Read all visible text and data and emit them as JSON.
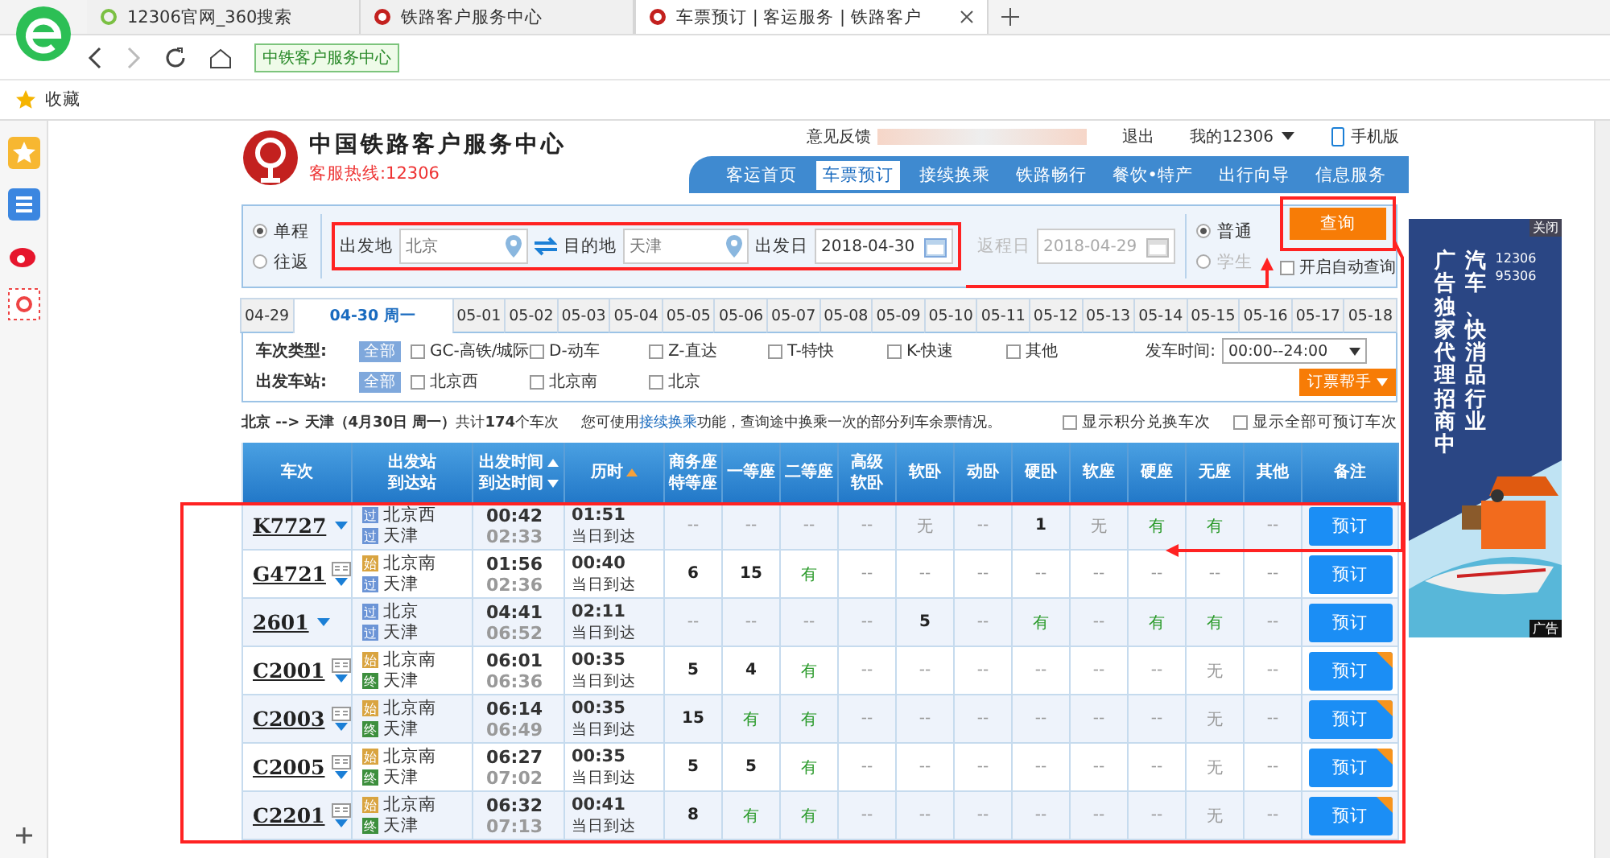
{
  "browser": {
    "tabs": [
      {
        "title": "12306官网_360搜索",
        "kind": "search",
        "selected": false
      },
      {
        "title": "铁路客户服务中心",
        "kind": "site",
        "selected": false
      },
      {
        "title": "车票预订 | 客运服务 | 铁路客户",
        "kind": "site",
        "selected": true
      }
    ],
    "site_badge": "中铁客户服务中心",
    "bookmarks_label": "收藏"
  },
  "header": {
    "title": "中国铁路客户服务中心",
    "hotline": "客服热线:12306",
    "feedback": "意见反馈",
    "logout": "退出",
    "account": "我的12306",
    "mobile": "手机版",
    "nav": [
      {
        "label": "客运首页",
        "selected": false
      },
      {
        "label": "车票预订",
        "selected": true
      },
      {
        "label": "接续换乘",
        "selected": false
      },
      {
        "label": "铁路畅行",
        "selected": false
      },
      {
        "label": "餐饮•特产",
        "selected": false
      },
      {
        "label": "出行向导",
        "selected": false
      },
      {
        "label": "信息服务",
        "selected": false
      }
    ]
  },
  "search": {
    "trip": [
      {
        "label": "单程",
        "selected": true
      },
      {
        "label": "往返",
        "selected": false
      }
    ],
    "from": {
      "label": "出发地",
      "value": "北京"
    },
    "to": {
      "label": "目的地",
      "value": "天津"
    },
    "date": {
      "label": "出发日",
      "value": "2018-04-30",
      "disabled": false
    },
    "return": {
      "label": "返程日",
      "value": "2018-04-29",
      "disabled": true
    },
    "passenger": [
      {
        "label": "普通",
        "selected": true,
        "disabled": false
      },
      {
        "label": "学生",
        "selected": false,
        "disabled": true
      }
    ],
    "submit": "查询",
    "auto_query": {
      "label": "开启自动查询",
      "checked": false
    }
  },
  "dates": [
    {
      "label": "04-29",
      "selected": false
    },
    {
      "label": "04-30 周一",
      "selected": true
    },
    {
      "label": "05-01",
      "selected": false
    },
    {
      "label": "05-02",
      "selected": false
    },
    {
      "label": "05-03",
      "selected": false
    },
    {
      "label": "05-04",
      "selected": false
    },
    {
      "label": "05-05",
      "selected": false
    },
    {
      "label": "05-06",
      "selected": false
    },
    {
      "label": "05-07",
      "selected": false
    },
    {
      "label": "05-08",
      "selected": false
    },
    {
      "label": "05-09",
      "selected": false
    },
    {
      "label": "05-10",
      "selected": false
    },
    {
      "label": "05-11",
      "selected": false
    },
    {
      "label": "05-12",
      "selected": false
    },
    {
      "label": "05-13",
      "selected": false
    },
    {
      "label": "05-14",
      "selected": false
    },
    {
      "label": "05-15",
      "selected": false
    },
    {
      "label": "05-16",
      "selected": false
    },
    {
      "label": "05-17",
      "selected": false
    },
    {
      "label": "05-18",
      "selected": false
    }
  ],
  "filters": [
    {
      "label": "车次类型:",
      "all": "全部",
      "options": [
        {
          "label": "GC-高铁/城际",
          "checked": false
        },
        {
          "label": "D-动车",
          "checked": false
        },
        {
          "label": "Z-直达",
          "checked": false
        },
        {
          "label": "T-特快",
          "checked": false
        },
        {
          "label": "K-快速",
          "checked": false
        },
        {
          "label": "其他",
          "checked": false
        }
      ]
    },
    {
      "label": "出发车站:",
      "all": "全部",
      "options": [
        {
          "label": "北京西",
          "checked": false
        },
        {
          "label": "北京南",
          "checked": false
        },
        {
          "label": "北京",
          "checked": false
        }
      ]
    }
  ],
  "time_filter": {
    "label": "发车时间:",
    "value": "00:00--24:00"
  },
  "helper": "订票帮手",
  "summary": "**北京 --> 天津（4月30日  周一）**共计**174**个车次",
  "tip": {
    "before": "您可使用",
    "link": "接续换乘",
    "after": "功能，查询途中换乘一次的部分列车余票情况。"
  },
  "options": [
    {
      "label": "显示积分兑换车次",
      "checked": false
    },
    {
      "label": "显示全部可预订车次",
      "checked": false
    }
  ],
  "table": {
    "columns": [
      {
        "lines": [
          "车次"
        ],
        "sortable": false,
        "sorted": false
      },
      {
        "lines": [
          "出发站",
          "到达站"
        ],
        "sortable": false,
        "sorted": false
      },
      {
        "lines": [
          "出发时间",
          "到达时间"
        ],
        "sortable": true,
        "sorted": false
      },
      {
        "lines": [
          "历时"
        ],
        "sortable": true,
        "sorted": true
      },
      {
        "lines": [
          "商务座",
          "特等座"
        ],
        "sortable": false,
        "sorted": false
      },
      {
        "lines": [
          "一等座"
        ],
        "sortable": false,
        "sorted": false
      },
      {
        "lines": [
          "二等座"
        ],
        "sortable": false,
        "sorted": false
      },
      {
        "lines": [
          "高级",
          "软卧"
        ],
        "sortable": false,
        "sorted": false
      },
      {
        "lines": [
          "软卧"
        ],
        "sortable": false,
        "sorted": false
      },
      {
        "lines": [
          "动卧"
        ],
        "sortable": false,
        "sorted": false
      },
      {
        "lines": [
          "硬卧"
        ],
        "sortable": false,
        "sorted": false
      },
      {
        "lines": [
          "软座"
        ],
        "sortable": false,
        "sorted": false
      },
      {
        "lines": [
          "硬座"
        ],
        "sortable": false,
        "sorted": false
      },
      {
        "lines": [
          "无座"
        ],
        "sortable": false,
        "sorted": false
      },
      {
        "lines": [
          "其他"
        ],
        "sortable": false,
        "sorted": false
      },
      {
        "lines": [
          "备注"
        ],
        "sortable": false,
        "sorted": false
      }
    ],
    "rows": [
      {
        "train": "K7727",
        "id_card": false,
        "from": {
          "badge": "过",
          "kind": "pass",
          "name": "北京西"
        },
        "to": {
          "badge": "过",
          "kind": "pass",
          "name": "天津"
        },
        "depart": "00:42",
        "arrive": "02:33",
        "duration": "01:51",
        "arrival_day": "当日到达",
        "seats": [
          {
            "value": "--",
            "kind": "dash"
          },
          {
            "value": "--",
            "kind": "dash"
          },
          {
            "value": "--",
            "kind": "dash"
          },
          {
            "value": "--",
            "kind": "dash"
          },
          {
            "value": "无",
            "kind": "none"
          },
          {
            "value": "--",
            "kind": "dash"
          },
          {
            "value": "1",
            "kind": "count"
          },
          {
            "value": "无",
            "kind": "none"
          },
          {
            "value": "有",
            "kind": "plenty"
          },
          {
            "value": "有",
            "kind": "plenty"
          },
          {
            "value": "--",
            "kind": "dash"
          }
        ],
        "book": "预订",
        "tagged": false
      },
      {
        "train": "G4721",
        "id_card": true,
        "from": {
          "badge": "始",
          "kind": "start",
          "name": "北京南"
        },
        "to": {
          "badge": "过",
          "kind": "pass",
          "name": "天津"
        },
        "depart": "01:56",
        "arrive": "02:36",
        "duration": "00:40",
        "arrival_day": "当日到达",
        "seats": [
          {
            "value": "6",
            "kind": "count"
          },
          {
            "value": "15",
            "kind": "count"
          },
          {
            "value": "有",
            "kind": "plenty"
          },
          {
            "value": "--",
            "kind": "dash"
          },
          {
            "value": "--",
            "kind": "dash"
          },
          {
            "value": "--",
            "kind": "dash"
          },
          {
            "value": "--",
            "kind": "dash"
          },
          {
            "value": "--",
            "kind": "dash"
          },
          {
            "value": "--",
            "kind": "dash"
          },
          {
            "value": "--",
            "kind": "dash"
          },
          {
            "value": "--",
            "kind": "dash"
          }
        ],
        "book": "预订",
        "tagged": false
      },
      {
        "train": "2601",
        "id_card": false,
        "from": {
          "badge": "过",
          "kind": "pass",
          "name": "北京"
        },
        "to": {
          "badge": "过",
          "kind": "pass",
          "name": "天津"
        },
        "depart": "04:41",
        "arrive": "06:52",
        "duration": "02:11",
        "arrival_day": "当日到达",
        "seats": [
          {
            "value": "--",
            "kind": "dash"
          },
          {
            "value": "--",
            "kind": "dash"
          },
          {
            "value": "--",
            "kind": "dash"
          },
          {
            "value": "--",
            "kind": "dash"
          },
          {
            "value": "5",
            "kind": "count"
          },
          {
            "value": "--",
            "kind": "dash"
          },
          {
            "value": "有",
            "kind": "plenty"
          },
          {
            "value": "--",
            "kind": "dash"
          },
          {
            "value": "有",
            "kind": "plenty"
          },
          {
            "value": "有",
            "kind": "plenty"
          },
          {
            "value": "--",
            "kind": "dash"
          }
        ],
        "book": "预订",
        "tagged": false
      },
      {
        "train": "C2001",
        "id_card": true,
        "from": {
          "badge": "始",
          "kind": "start",
          "name": "北京南"
        },
        "to": {
          "badge": "终",
          "kind": "end",
          "name": "天津"
        },
        "depart": "06:01",
        "arrive": "06:36",
        "duration": "00:35",
        "arrival_day": "当日到达",
        "seats": [
          {
            "value": "5",
            "kind": "count"
          },
          {
            "value": "4",
            "kind": "count"
          },
          {
            "value": "有",
            "kind": "plenty"
          },
          {
            "value": "--",
            "kind": "dash"
          },
          {
            "value": "--",
            "kind": "dash"
          },
          {
            "value": "--",
            "kind": "dash"
          },
          {
            "value": "--",
            "kind": "dash"
          },
          {
            "value": "--",
            "kind": "dash"
          },
          {
            "value": "--",
            "kind": "dash"
          },
          {
            "value": "无",
            "kind": "none"
          },
          {
            "value": "--",
            "kind": "dash"
          }
        ],
        "book": "预订",
        "tagged": true
      },
      {
        "train": "C2003",
        "id_card": true,
        "from": {
          "badge": "始",
          "kind": "start",
          "name": "北京南"
        },
        "to": {
          "badge": "终",
          "kind": "end",
          "name": "天津"
        },
        "depart": "06:14",
        "arrive": "06:49",
        "duration": "00:35",
        "arrival_day": "当日到达",
        "seats": [
          {
            "value": "15",
            "kind": "count"
          },
          {
            "value": "有",
            "kind": "plenty"
          },
          {
            "value": "有",
            "kind": "plenty"
          },
          {
            "value": "--",
            "kind": "dash"
          },
          {
            "value": "--",
            "kind": "dash"
          },
          {
            "value": "--",
            "kind": "dash"
          },
          {
            "value": "--",
            "kind": "dash"
          },
          {
            "value": "--",
            "kind": "dash"
          },
          {
            "value": "--",
            "kind": "dash"
          },
          {
            "value": "无",
            "kind": "none"
          },
          {
            "value": "--",
            "kind": "dash"
          }
        ],
        "book": "预订",
        "tagged": true
      },
      {
        "train": "C2005",
        "id_card": true,
        "from": {
          "badge": "始",
          "kind": "start",
          "name": "北京南"
        },
        "to": {
          "badge": "终",
          "kind": "end",
          "name": "天津"
        },
        "depart": "06:27",
        "arrive": "07:02",
        "duration": "00:35",
        "arrival_day": "当日到达",
        "seats": [
          {
            "value": "5",
            "kind": "count"
          },
          {
            "value": "5",
            "kind": "count"
          },
          {
            "value": "有",
            "kind": "plenty"
          },
          {
            "value": "--",
            "kind": "dash"
          },
          {
            "value": "--",
            "kind": "dash"
          },
          {
            "value": "--",
            "kind": "dash"
          },
          {
            "value": "--",
            "kind": "dash"
          },
          {
            "value": "--",
            "kind": "dash"
          },
          {
            "value": "--",
            "kind": "dash"
          },
          {
            "value": "无",
            "kind": "none"
          },
          {
            "value": "--",
            "kind": "dash"
          }
        ],
        "book": "预订",
        "tagged": true
      },
      {
        "train": "C2201",
        "id_card": true,
        "from": {
          "badge": "始",
          "kind": "start",
          "name": "北京南"
        },
        "to": {
          "badge": "终",
          "kind": "end",
          "name": "天津"
        },
        "depart": "06:32",
        "arrive": "07:13",
        "duration": "00:41",
        "arrival_day": "当日到达",
        "seats": [
          {
            "value": "8",
            "kind": "count"
          },
          {
            "value": "有",
            "kind": "plenty"
          },
          {
            "value": "有",
            "kind": "plenty"
          },
          {
            "value": "--",
            "kind": "dash"
          },
          {
            "value": "--",
            "kind": "dash"
          },
          {
            "value": "--",
            "kind": "dash"
          },
          {
            "value": "--",
            "kind": "dash"
          },
          {
            "value": "--",
            "kind": "dash"
          },
          {
            "value": "--",
            "kind": "dash"
          },
          {
            "value": "无",
            "kind": "none"
          },
          {
            "value": "--",
            "kind": "dash"
          }
        ],
        "book": "预订",
        "tagged": true
      }
    ]
  },
  "ad": {
    "close": "关闭",
    "line_1": "汽车、快消品行业",
    "line_2": "广告独家代理招商中",
    "phone_1": "12306",
    "phone_2": "95306",
    "tag": "广告"
  }
}
